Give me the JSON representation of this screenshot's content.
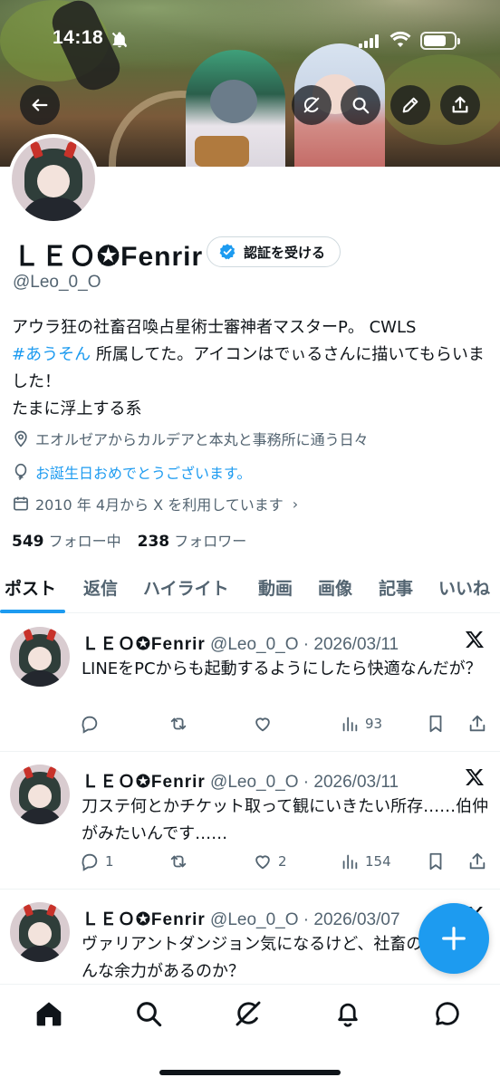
{
  "status_bar": {
    "time": "14:18",
    "battery_level": 0.75,
    "icons": [
      "bell-slash-icon",
      "cellular-signal-icon",
      "wifi-icon",
      "battery-icon"
    ]
  },
  "banner": {
    "buttons": [
      "back-arrow-icon",
      "grok-icon",
      "search-icon",
      "pencil-icon",
      "share-icon"
    ]
  },
  "profile": {
    "display_name": "ＬＥＯ✪Fenrir",
    "verify_button_label": "認証を受ける",
    "handle": "@Leo_0_O",
    "bio_line1_prefix": "アウラ狂の社畜召喚占星術士審神者マスターP。 CWLS",
    "bio_hashtag": "#あうそん",
    "bio_line1_suffix": " 所属してた。アイコンはでぃるさんに描いてもらいました！",
    "bio_line2": "たまに浮上する系",
    "location": "エオルゼアからカルデアと本丸と事務所に通う日々",
    "birthday_text": "お誕生日おめでとうございます。",
    "joined": "2010 年 4月から X を利用しています",
    "joined_chevron": "›",
    "following_count": "549",
    "following_label": "フォロー中",
    "followers_count": "238",
    "followers_label": "フォロワー"
  },
  "tabs": [
    {
      "label": "ポスト",
      "active": true
    },
    {
      "label": "返信",
      "active": false
    },
    {
      "label": "ハイライト",
      "active": false
    },
    {
      "label": "動画",
      "active": false
    },
    {
      "label": "画像",
      "active": false
    },
    {
      "label": "記事",
      "active": false
    },
    {
      "label": "いいね",
      "active": false
    }
  ],
  "posts": [
    {
      "name": "ＬＥＯ✪Fenrir",
      "meta": " @Leo_0_O · 2026/03/11",
      "text": "LINEをPCからも起動するようにしたら快適なんだが？",
      "replies": "",
      "reposts": "",
      "likes": "",
      "views": "93"
    },
    {
      "name": "ＬＥＯ✪Fenrir",
      "meta": " @Leo_0_O · 2026/03/11",
      "text": "刀ステ何とかチケット取って観にいきたい所存……伯仲がみたいんです……",
      "replies": "1",
      "reposts": "",
      "likes": "2",
      "views": "154"
    },
    {
      "name": "ＬＥＯ✪Fenrir",
      "meta": " @Leo_0_O · 2026/03/07",
      "text": "ヴァリアントダンジョン気になるけど、社畜のどこにそんな余力があるのか？"
    }
  ],
  "bottom_nav": [
    "home-icon",
    "search-icon",
    "grok-icon",
    "notifications-icon",
    "messages-icon"
  ],
  "colors": {
    "accent": "#1d9bf0",
    "text_primary": "#0f1419",
    "text_secondary": "#536471",
    "divider": "#eff3f4"
  }
}
